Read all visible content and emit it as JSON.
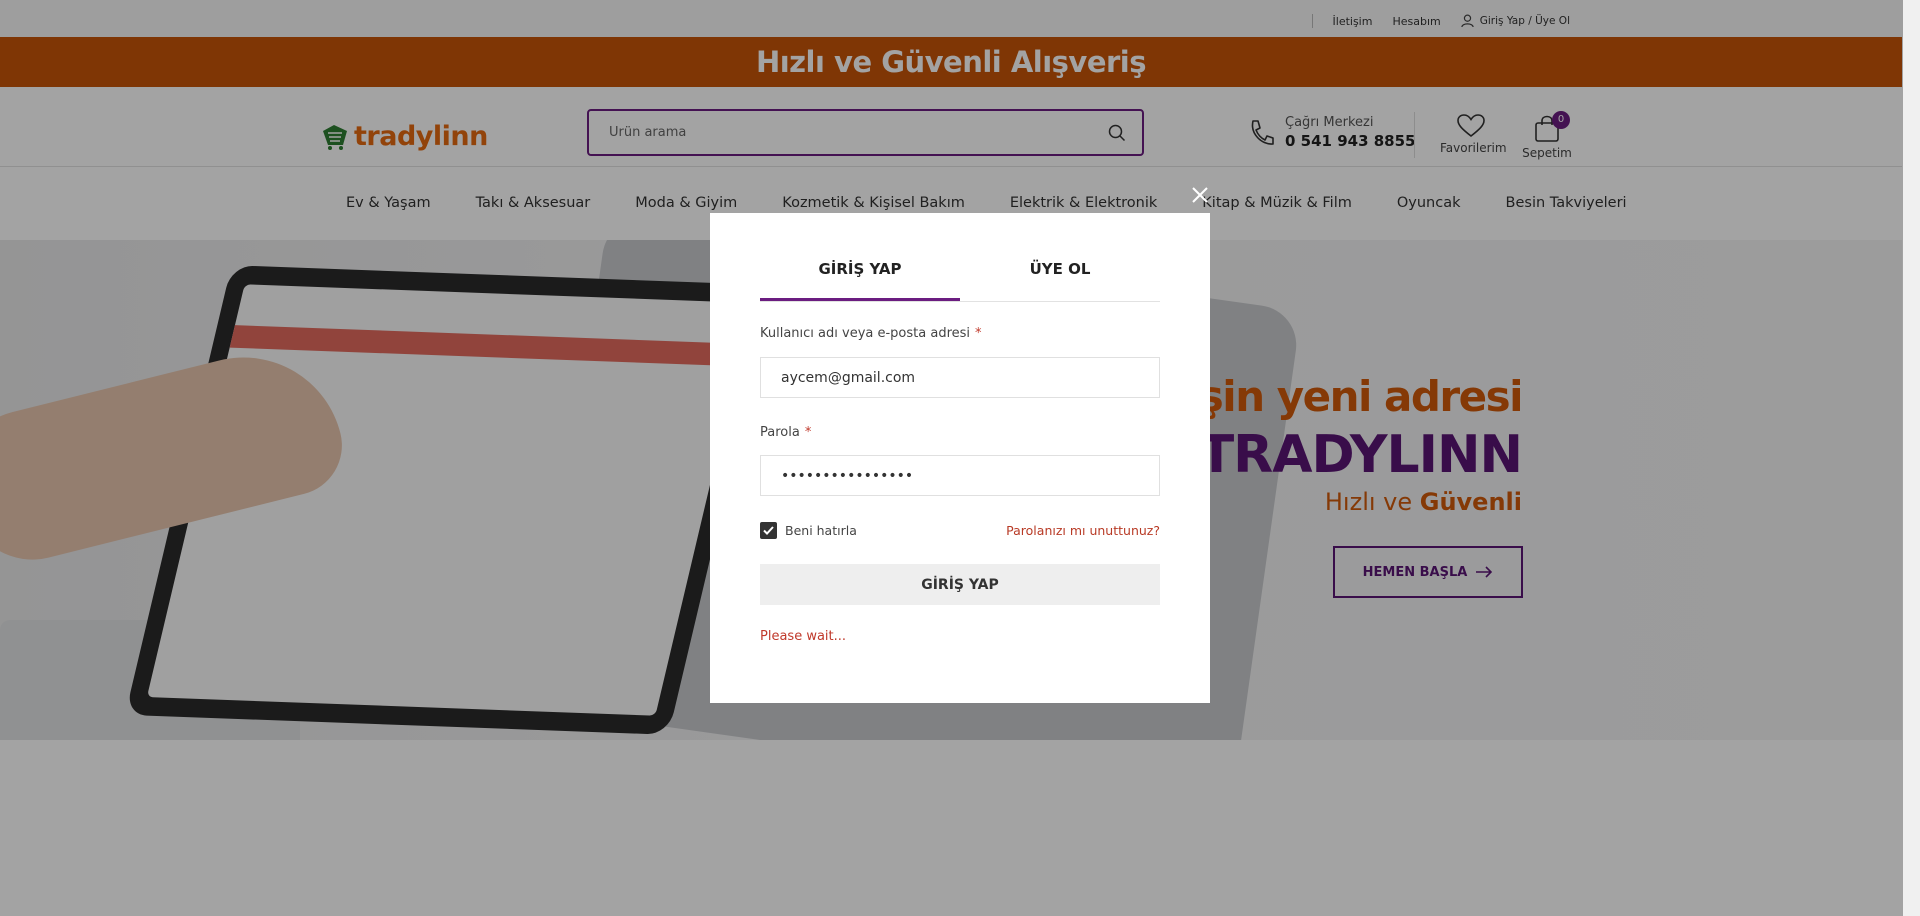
{
  "topbar": {
    "contact": "İletişim",
    "account": "Hesabım",
    "login_register": "Giriş Yap / Üye Ol"
  },
  "announcement": "Hızlı ve Güvenli Alışveriş",
  "header": {
    "logo_text": "tradylinn",
    "search_placeholder": "Ürün arama",
    "call_center_label": "Çağrı Merkezi",
    "call_center_phone": "0 541 943 8855",
    "favorites_label": "Favorilerim",
    "cart_label": "Sepetim",
    "cart_count": "0"
  },
  "nav": {
    "items": [
      "Ev & Yaşam",
      "Takı & Aksesuar",
      "Moda & Giyim",
      "Kozmetik & Kişisel Bakım",
      "Elektrik & Elektronik",
      "Kitap & Müzik & Film",
      "Oyuncak",
      "Besin Takviyeleri"
    ]
  },
  "hero": {
    "tagline_1": "erişin yeni adresi",
    "tagline_2": "TRADYLINN",
    "tagline_3a": "Hızlı ve ",
    "tagline_3b": "Güvenli",
    "cta_label": "HEMEN BAŞLA"
  },
  "modal": {
    "tab_login": "GİRİŞ YAP",
    "tab_register": "ÜYE OL",
    "username_label": "Kullanıcı adı veya e-posta adresi",
    "required_mark": "*",
    "username_value": "aycem@gmail.com",
    "password_label": "Parola",
    "password_value": "••••••••••••••••",
    "remember_label": "Beni hatırla",
    "remember_checked": true,
    "forgot_link": "Parolanızı mı unuttunuz?",
    "submit_label": "GİRİŞ YAP",
    "status_text": "Please wait..."
  },
  "colors": {
    "brand_orange": "#c75508",
    "brand_purple": "#6b1d80",
    "error_red": "#c0392b"
  }
}
